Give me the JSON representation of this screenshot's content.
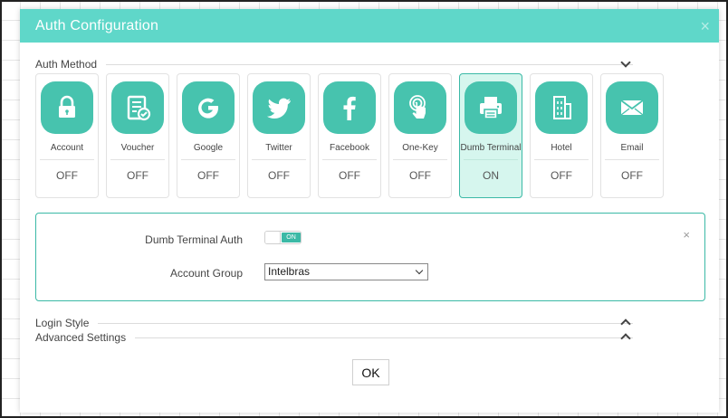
{
  "dialog": {
    "title": "Auth Configuration",
    "close_glyph": "×"
  },
  "auth_method": {
    "label": "Auth Method",
    "collapse_icon": "chevron-down-icon",
    "methods": [
      {
        "label": "Account",
        "status": "OFF",
        "icon": "lock-icon"
      },
      {
        "label": "Voucher",
        "status": "OFF",
        "icon": "voucher-icon"
      },
      {
        "label": "Google",
        "status": "OFF",
        "icon": "google-icon"
      },
      {
        "label": "Twitter",
        "status": "OFF",
        "icon": "twitter-icon"
      },
      {
        "label": "Facebook",
        "status": "OFF",
        "icon": "facebook-icon"
      },
      {
        "label": "One-Key",
        "status": "OFF",
        "icon": "touch-icon"
      },
      {
        "label": "Dumb Terminal",
        "status": "ON",
        "icon": "printer-icon",
        "active": true
      },
      {
        "label": "Hotel",
        "status": "OFF",
        "icon": "building-icon"
      },
      {
        "label": "Email",
        "status": "OFF",
        "icon": "envelope-icon"
      }
    ]
  },
  "detail": {
    "close_glyph": "×",
    "toggle_label": "Dumb Terminal Auth",
    "toggle_state": "ON",
    "account_group_label": "Account Group",
    "account_group_value": "Intelbras"
  },
  "sections": {
    "login_style": "Login Style",
    "advanced_settings": "Advanced Settings"
  },
  "ok_label": "OK",
  "colors": {
    "accent": "#5fd7c9",
    "tile": "#47c3ae",
    "active_bg": "#d6f6ee",
    "active_border": "#3bb9a6"
  }
}
